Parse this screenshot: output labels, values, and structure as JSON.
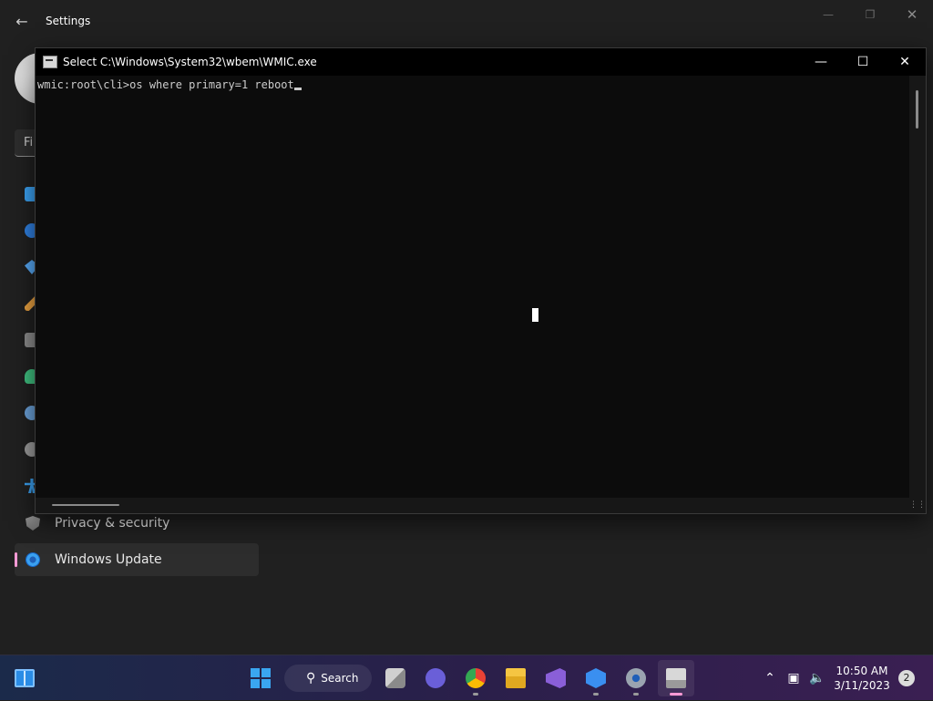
{
  "settings": {
    "title": "Settings",
    "find_placeholder": "Fi",
    "nav_items": [
      {
        "label": "Privacy & security",
        "icon": "shield-icon",
        "active": false
      },
      {
        "label": "Windows Update",
        "icon": "windows-update-icon",
        "active": true
      }
    ]
  },
  "console": {
    "title": "Select C:\\Windows\\System32\\wbem\\WMIC.exe",
    "command_line": "wmic:root\\cli>os where primary=1 reboot",
    "minimize": "—",
    "maximize": "☐",
    "close": "✕"
  },
  "taskbar": {
    "search_label": "Search",
    "apps": [
      "start-icon",
      "task-view-icon",
      "meet-icon",
      "chrome-icon",
      "file-explorer-icon",
      "visual-studio-icon",
      "cube-app-icon",
      "settings-icon",
      "wmic-console-icon"
    ],
    "time": "10:50 AM",
    "date": "3/11/2023",
    "notification_count": "2"
  },
  "colors": {
    "accent": "#ff9ad5",
    "console_bg": "#0c0c0c",
    "console_text": "#cccccc"
  }
}
